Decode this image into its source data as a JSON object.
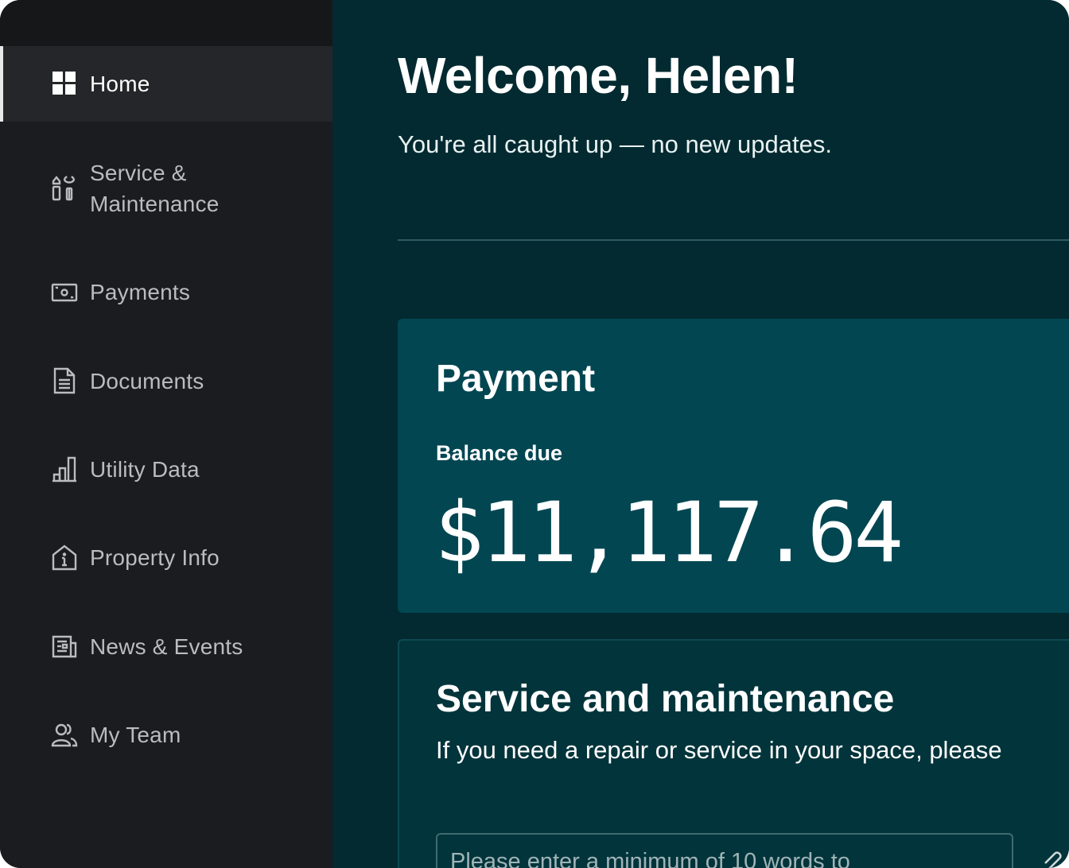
{
  "sidebar": {
    "items": [
      {
        "label": "Home",
        "icon": "grid-icon",
        "active": true
      },
      {
        "label": "Service & Maintenance",
        "icon": "tools-icon",
        "active": false
      },
      {
        "label": "Payments",
        "icon": "cash-icon",
        "active": false
      },
      {
        "label": "Documents",
        "icon": "document-icon",
        "active": false
      },
      {
        "label": "Utility Data",
        "icon": "bar-chart-icon",
        "active": false
      },
      {
        "label": "Property Info",
        "icon": "house-info-icon",
        "active": false
      },
      {
        "label": "News & Events",
        "icon": "newspaper-icon",
        "active": false
      },
      {
        "label": "My Team",
        "icon": "people-icon",
        "active": false
      }
    ]
  },
  "main": {
    "welcome": "Welcome, Helen!",
    "subtitle": "You're all caught up — no new updates.",
    "payment": {
      "title": "Payment",
      "balance_label": "Balance due",
      "balance_amount": "$11,117.64"
    },
    "service": {
      "title": "Service and maintenance",
      "description": "If you need a repair or service in your space, please",
      "input_placeholder": "Please enter a minimum of 10 words to"
    }
  },
  "colors": {
    "sidebar_bg": "#1b1c1f",
    "main_bg": "#022a30",
    "payment_card_bg": "#024652",
    "service_card_bg": "#02343b"
  }
}
